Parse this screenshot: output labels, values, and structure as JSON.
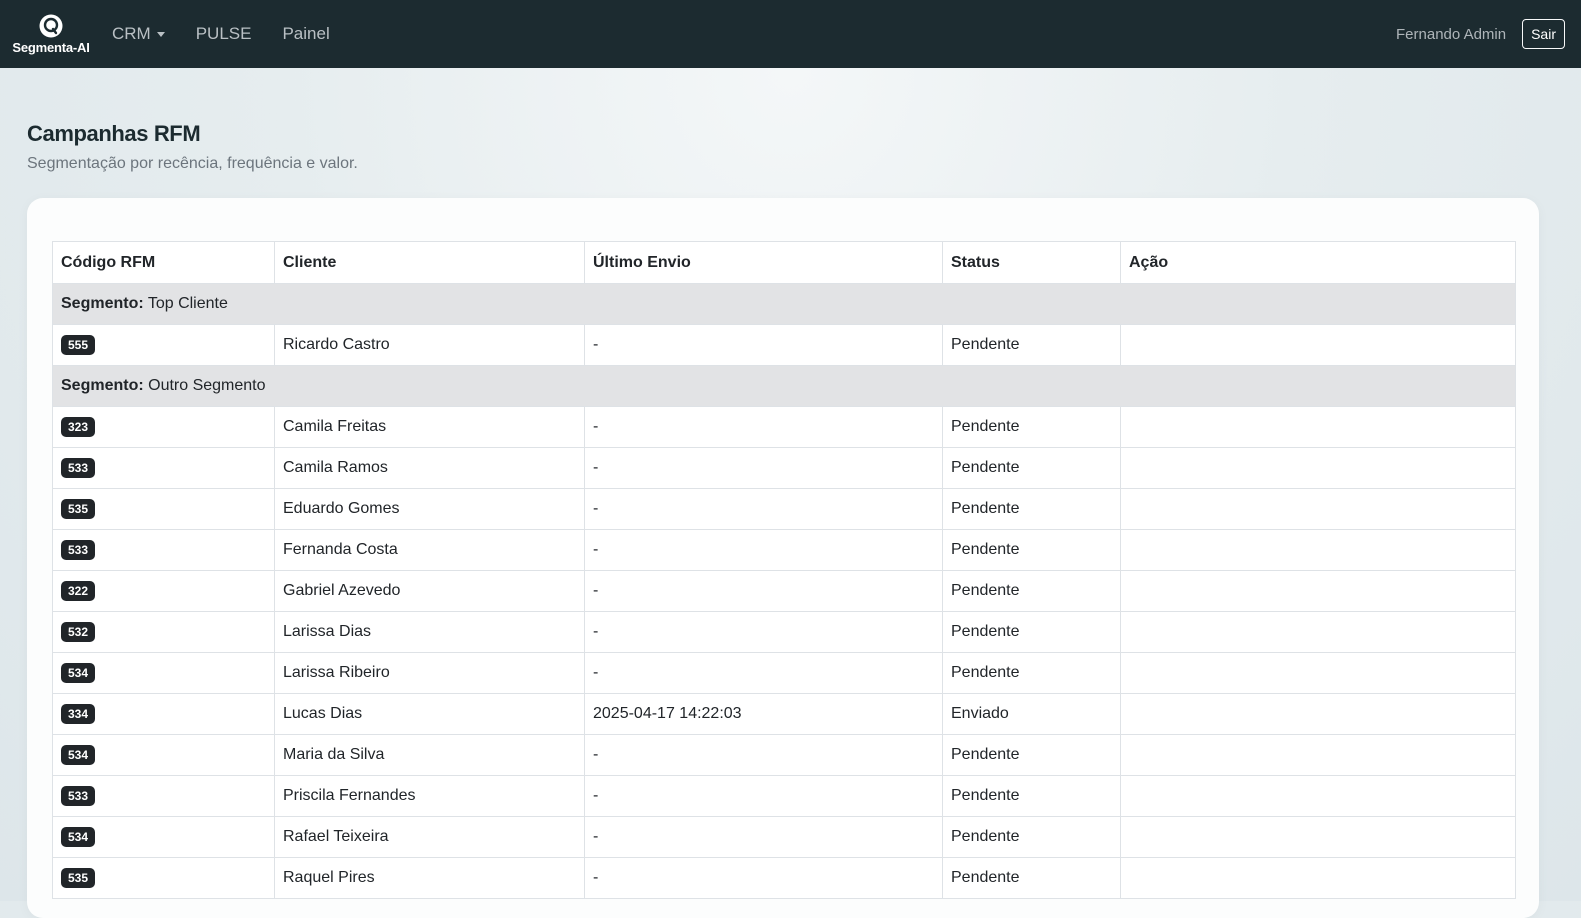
{
  "navbar": {
    "brand": "Segmenta-AI",
    "items": [
      {
        "label": "CRM",
        "dropdown": true
      },
      {
        "label": "PULSE"
      },
      {
        "label": "Painel"
      }
    ],
    "user": "Fernando Admin",
    "logout_label": "Sair"
  },
  "page": {
    "title": "Campanhas RFM",
    "subtitle": "Segmentação por recência, frequência e valor."
  },
  "table": {
    "headers": [
      "Código RFM",
      "Cliente",
      "Último Envio",
      "Status",
      "Ação"
    ],
    "segment_label": "Segmento:",
    "segments": [
      {
        "name": "Top Cliente",
        "rows": [
          {
            "code": "555",
            "client": "Ricardo Castro",
            "last_sent": "-",
            "status": "Pendente",
            "action": ""
          }
        ]
      },
      {
        "name": "Outro Segmento",
        "rows": [
          {
            "code": "323",
            "client": "Camila Freitas",
            "last_sent": "-",
            "status": "Pendente",
            "action": ""
          },
          {
            "code": "533",
            "client": "Camila Ramos",
            "last_sent": "-",
            "status": "Pendente",
            "action": ""
          },
          {
            "code": "535",
            "client": "Eduardo Gomes",
            "last_sent": "-",
            "status": "Pendente",
            "action": ""
          },
          {
            "code": "533",
            "client": "Fernanda Costa",
            "last_sent": "-",
            "status": "Pendente",
            "action": ""
          },
          {
            "code": "322",
            "client": "Gabriel Azevedo",
            "last_sent": "-",
            "status": "Pendente",
            "action": ""
          },
          {
            "code": "532",
            "client": "Larissa Dias",
            "last_sent": "-",
            "status": "Pendente",
            "action": ""
          },
          {
            "code": "534",
            "client": "Larissa Ribeiro",
            "last_sent": "-",
            "status": "Pendente",
            "action": ""
          },
          {
            "code": "334",
            "client": "Lucas Dias",
            "last_sent": "2025-04-17 14:22:03",
            "status": "Enviado",
            "action": ""
          },
          {
            "code": "534",
            "client": "Maria da Silva",
            "last_sent": "-",
            "status": "Pendente",
            "action": ""
          },
          {
            "code": "533",
            "client": "Priscila Fernandes",
            "last_sent": "-",
            "status": "Pendente",
            "action": ""
          },
          {
            "code": "534",
            "client": "Rafael Teixeira",
            "last_sent": "-",
            "status": "Pendente",
            "action": ""
          },
          {
            "code": "535",
            "client": "Raquel Pires",
            "last_sent": "-",
            "status": "Pendente",
            "action": ""
          }
        ]
      }
    ]
  }
}
